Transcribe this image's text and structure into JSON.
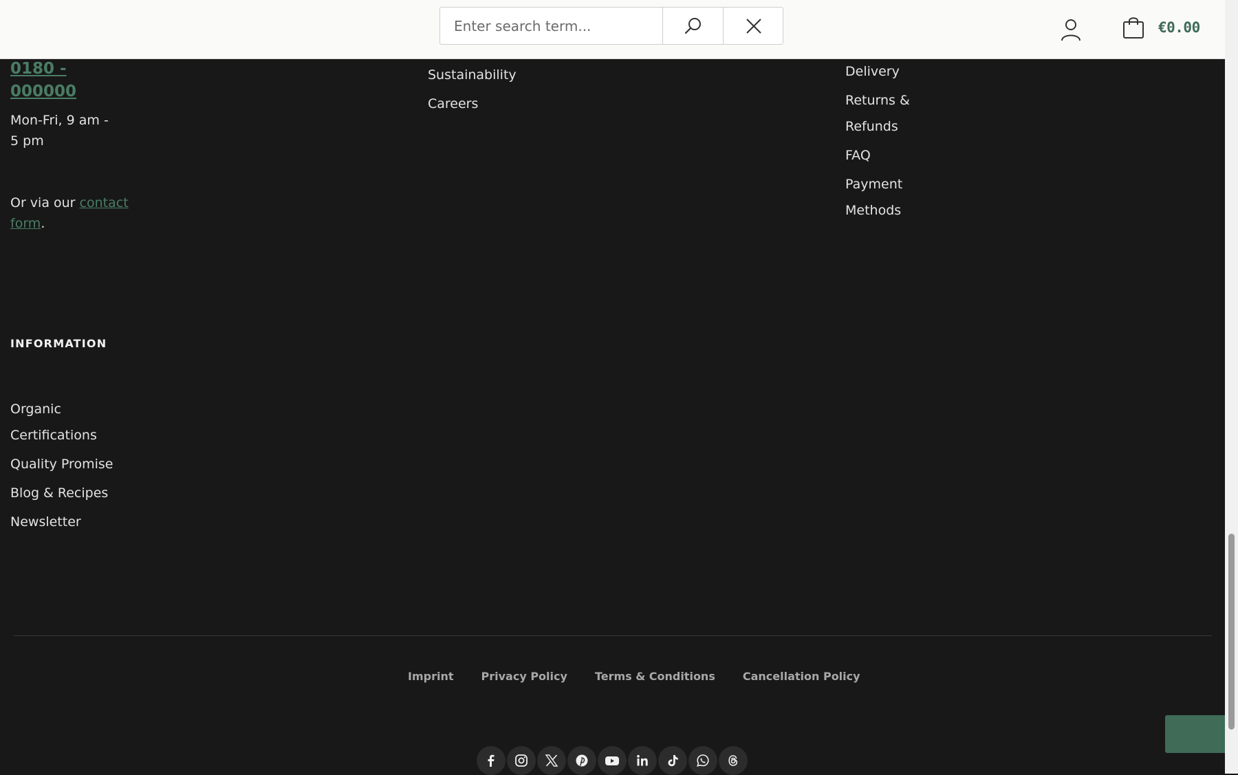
{
  "header": {
    "search": {
      "placeholder": "Enter search term...",
      "value": ""
    },
    "cart_total": "€0.00"
  },
  "contact": {
    "phone": "0180 - 000000",
    "hours": "Mon-Fri, 9 am - 5 pm",
    "or_via": "Or via our",
    "contact_form": "contact form",
    "period": "."
  },
  "company_links": [
    "Sustainability",
    "Careers"
  ],
  "service_links": [
    "Delivery",
    "Returns & Refunds",
    "FAQ",
    "Payment Methods"
  ],
  "information": {
    "heading": "INFORMATION",
    "links": [
      "Organic Certifications",
      "Quality Promise",
      "Blog & Recipes",
      "Newsletter"
    ]
  },
  "legal_links": [
    "Imprint",
    "Privacy Policy",
    "Terms & Conditions",
    "Cancellation Policy"
  ],
  "social": [
    "facebook-icon",
    "instagram-icon",
    "x-icon",
    "pinterest-icon",
    "youtube-icon",
    "linkedin-icon",
    "tiktok-icon",
    "whatsapp-icon",
    "threads-icon"
  ],
  "colors": {
    "accent": "#3f6b57",
    "link": "#4a7d65",
    "background": "#181818"
  }
}
